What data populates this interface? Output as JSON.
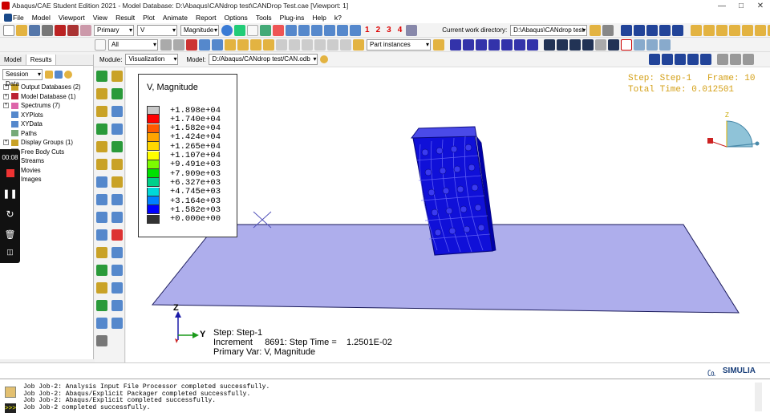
{
  "window": {
    "title": "Abaqus/CAE Student Edition 2021 - Model Database: D:\\Abaqus\\CANdrop test\\CANDrop Test.cae [Viewport: 1]"
  },
  "menu": [
    "File",
    "Model",
    "Viewport",
    "View",
    "Result",
    "Plot",
    "Animate",
    "Report",
    "Options",
    "Tools",
    "Plug-ins",
    "Help",
    "k?"
  ],
  "toolbar1": {
    "step_select": "Primary",
    "var_select": "V",
    "invariant_select": "Magnitude",
    "cwd_label": "Current work directory:",
    "cwd_value": "D:\\Abaqus\\CANdrop test",
    "numbers": [
      "1",
      "2",
      "3",
      "4"
    ]
  },
  "toolbar2": {
    "filter_select": "All",
    "part_instances": "Part instances"
  },
  "toolbar3": {
    "module_label": "Module:",
    "module_value": "Visualization",
    "model_label": "Model:",
    "model_value": "D:/Abaqus/CANdrop test/CAN.odb"
  },
  "tree": {
    "tabs": [
      "Model",
      "Results"
    ],
    "session": "Session Data",
    "items": [
      {
        "label": "Output Databases (2)",
        "exp": true
      },
      {
        "label": "Model Database (1)",
        "exp": true
      },
      {
        "label": "Spectrums (7)",
        "exp": true
      },
      {
        "label": "XYPlots",
        "exp": false
      },
      {
        "label": "XYData",
        "exp": false
      },
      {
        "label": "Paths",
        "exp": false
      },
      {
        "label": "Display Groups (1)",
        "exp": true
      },
      {
        "label": "Free Body Cuts",
        "exp": false
      },
      {
        "label": "Streams",
        "exp": false
      },
      {
        "label": "Movies",
        "exp": false
      },
      {
        "label": "Images",
        "exp": false
      }
    ]
  },
  "recorder": {
    "time": "00:08"
  },
  "legend": {
    "title": "V, Magnitude",
    "values": [
      "+1.898e+04",
      "+1.740e+04",
      "+1.582e+04",
      "+1.424e+04",
      "+1.265e+04",
      "+1.107e+04",
      "+9.491e+03",
      "+7.909e+03",
      "+6.327e+03",
      "+4.745e+03",
      "+3.164e+03",
      "+1.582e+03",
      "+0.000e+00"
    ],
    "colors": [
      "#c8c8c8",
      "#ff0000",
      "#ff5a00",
      "#ffa500",
      "#ffd700",
      "#ffff00",
      "#7cfc00",
      "#00e000",
      "#00d08a",
      "#00d8d8",
      "#0080ff",
      "#0000ff",
      "#333333"
    ]
  },
  "step_info_tr": {
    "line1": "Step: Step-1   Frame: 10",
    "line2": "Total Time: 0.012501"
  },
  "step_info_bl": {
    "line1": "Step: Step-1",
    "line2": "Increment     8691: Step Time =    1.2501E-02",
    "line3": "Primary Var: V, Magnitude"
  },
  "axes": {
    "z": "Z",
    "y": "Y",
    "triad_z": "Z"
  },
  "brand": "SIMULIA",
  "messages": [
    "Job Job-2: Analysis Input File Processor completed successfully.",
    "Job Job-2: Abaqus/Explicit Packager completed successfully.",
    "Job Job-2: Abaqus/Explicit completed successfully.",
    "Job Job-2 completed successfully."
  ]
}
